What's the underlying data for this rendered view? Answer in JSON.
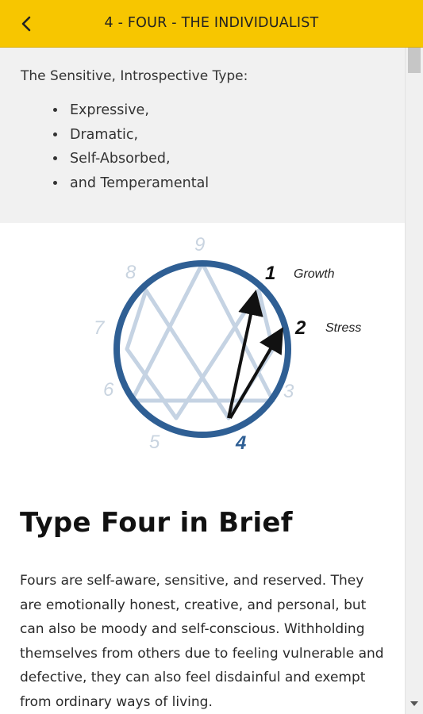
{
  "header": {
    "title": "4 - FOUR - THE INDIVIDUALIST",
    "back_icon": "chevron-left-icon"
  },
  "intro": {
    "lead": "The Sensitive, Introspective Type:",
    "traits": [
      "Expressive,",
      "Dramatic,",
      "Self-Absorbed,",
      "and Temperamental"
    ]
  },
  "diagram": {
    "numbers": [
      "9",
      "1",
      "2",
      "3",
      "4",
      "5",
      "6",
      "7",
      "8"
    ],
    "growth_label": "Growth",
    "stress_label": "Stress",
    "colors": {
      "circle": "#2f5f94",
      "lines": "#c5d3e3",
      "faded_number": "#c9d4e0",
      "active": "#111111"
    }
  },
  "article": {
    "heading": "Type Four in Brief",
    "body": "Fours are self-aware, sensitive, and reserved. They are emotionally honest, creative, and personal, but can also be moody and self-conscious. Withholding themselves from others due to feeling vulnerable and defective, they can also feel disdainful and exempt from ordinary ways of living."
  },
  "theme": {
    "appbar_bg": "#f7c600"
  }
}
